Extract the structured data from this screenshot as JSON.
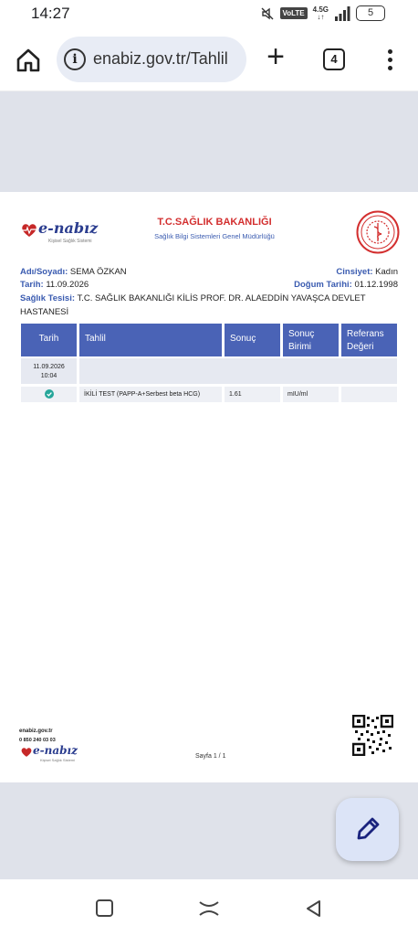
{
  "status": {
    "time": "14:27",
    "volte": "VoLTE",
    "network": "4.5G",
    "battery": "5"
  },
  "browser": {
    "url": "enabiz.gov.tr/Tahlil",
    "tab_count": "4"
  },
  "document": {
    "logo_text": "e-nabız",
    "logo_subtitle": "Kişisel Sağlık Sistemi",
    "ministry_title": "T.C.SAĞLIK BAKANLIĞI",
    "ministry_subtitle": "Sağlık Bilgi Sistemleri Genel Müdürlüğü",
    "patient": {
      "name_label": "Adı/Soyadı:",
      "name": "SEMA ÖZKAN",
      "gender_label": "Cinsiyet:",
      "gender": "Kadın",
      "date_label": "Tarih:",
      "date": "11.09.2026",
      "birth_label": "Doğum Tarihi:",
      "birth": "01.12.1998",
      "facility_label": "Sağlık Tesisi:",
      "facility_line1": "T.C. SAĞLIK BAKANLIĞI KİLİS PROF. DR. ALAEDDİN YAVAŞCA DEVLET",
      "facility_line2": "HASTANESİ"
    },
    "table": {
      "headers": {
        "date": "Tarih",
        "test": "Tahlil",
        "result": "Sonuç",
        "unit_line1": "Sonuç",
        "unit_line2": "Birimi",
        "ref_line1": "Referans",
        "ref_line2": "Değeri"
      },
      "group_date": "11.09.2026",
      "group_time": "10:04",
      "rows": [
        {
          "test": "İKİLİ TEST (PAPP-A+Serbest beta HCG)",
          "result": "1.61",
          "unit": "mIU/ml",
          "ref": ""
        }
      ]
    },
    "footer": {
      "site": "enabiz.gov.tr",
      "phone": "0 850 240 03 03",
      "page": "Sayfa 1 / 1"
    }
  },
  "colors": {
    "brand_blue": "#4a63b6",
    "brand_red": "#d32f2f",
    "viewer_gray": "#dfe2ea"
  }
}
